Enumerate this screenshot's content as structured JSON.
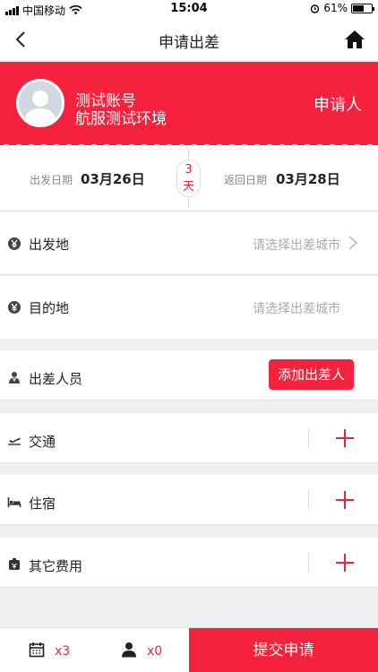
{
  "status_bar": {
    "carrier": "中国移动",
    "time": "15:04",
    "battery": "61%",
    "battery_level": 0.61
  },
  "nav": {
    "title": "申请出差"
  },
  "applicant": {
    "name": "测试账号",
    "env": "航服测试环境",
    "role": "申请人"
  },
  "dates": {
    "departure_label": "出发日期",
    "departure_value": "03月26日",
    "days_count": "3",
    "days_unit": "天",
    "return_label": "返回日期",
    "return_value": "03月28日"
  },
  "origin": {
    "label": "出发地",
    "placeholder": "请选择出差城市"
  },
  "destination": {
    "label": "目的地",
    "placeholder": "请选择出差城市"
  },
  "travelers": {
    "label": "出差人员",
    "add_label": "添加出差人"
  },
  "transport": {
    "label": "交通"
  },
  "lodging": {
    "label": "住宿"
  },
  "other_costs": {
    "label": "其它费用"
  },
  "bottom": {
    "trip_count": "x3",
    "person_count": "x0",
    "submit_label": "提交申请"
  },
  "colors": {
    "accent": "#f5223e"
  }
}
